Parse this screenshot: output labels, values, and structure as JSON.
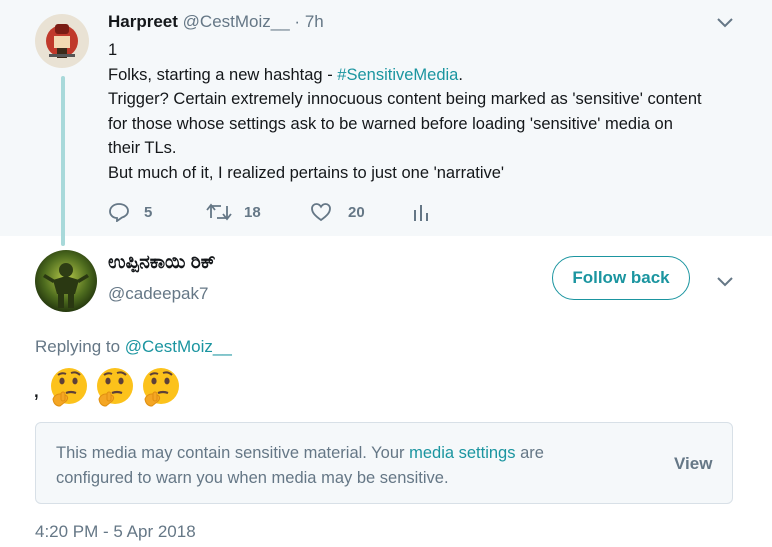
{
  "parent_tweet": {
    "name": "Harpreet",
    "handle": "@CestMoiz__",
    "separator": "·",
    "time": "7h",
    "lines": [
      "1",
      "Folks, starting a new hashtag - ",
      "Trigger? Certain extremely innocuous content being marked as 'sensitive' content",
      "for those whose settings ask to be warned before loading 'sensitive' media on",
      "their TLs.",
      "But much of it, I realized pertains to just one 'narrative'"
    ],
    "hashtag": "#SensitiveMedia",
    "after_hashtag": ".",
    "actions": {
      "reply_count": "5",
      "retweet_count": "18",
      "like_count": "20"
    }
  },
  "reply_tweet": {
    "name": "ಉಪ್ಪಿನಕಾಯಿ ರಿಕ್",
    "handle": "@cadeepak7",
    "follow_label": "Follow back",
    "replying_prefix": "Replying to ",
    "replying_handle": "@CestMoiz__",
    "text": ",",
    "emoji": [
      "thinking-face",
      "thinking-face",
      "thinking-face"
    ],
    "sensitive_notice": {
      "text_before": "This media may contain sensitive material. Your ",
      "link": "media settings",
      "text_after_line1": " are",
      "line2": "configured to warn you when media may be sensitive.",
      "view_label": "View"
    },
    "timestamp": "4:20 PM - 5 Apr 2018"
  },
  "colors": {
    "accent": "#1b95a0",
    "muted": "#657786",
    "thread_line": "#a8d9da",
    "parent_bg": "#f5f8fa"
  }
}
